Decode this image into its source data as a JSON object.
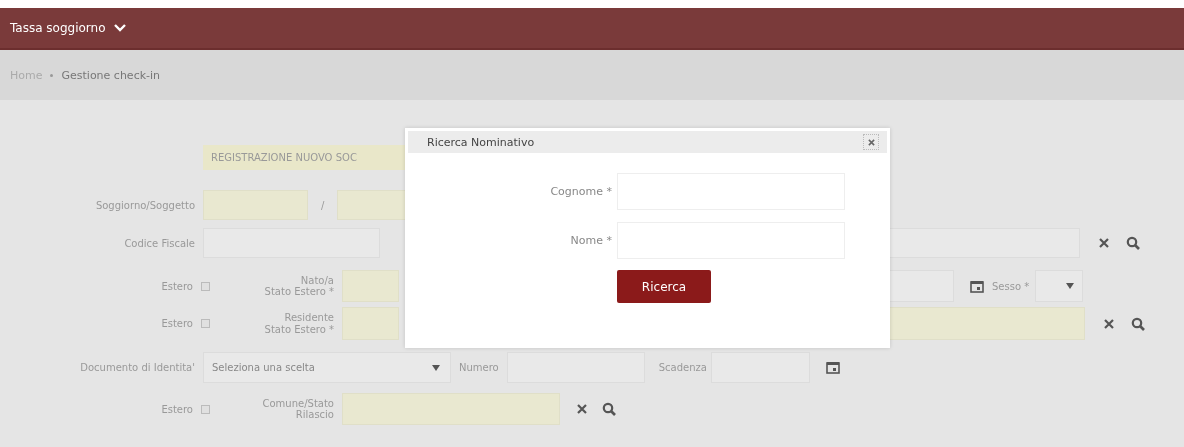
{
  "header": {
    "title": "Tassa soggiorno"
  },
  "breadcrumb": [
    "Home",
    "Gestione check-in"
  ],
  "form": {
    "banner": "REGISTRAZIONE NUOVO SOC",
    "soggiorno_label": "Soggiorno/Soggetto",
    "separator": "/",
    "codice_fiscale_label": "Codice Fiscale",
    "nascita": {
      "estero_label": "Estero",
      "estero_checked": false,
      "label": "Nato/a\nStato Estero *",
      "sesso_label": "Sesso *"
    },
    "residenza": {
      "estero_label": "Estero",
      "estero_checked": false,
      "label": "Residente\nStato Estero *"
    },
    "documento": {
      "label": "Documento di Identita'",
      "select_placeholder": "Seleziona una scelta",
      "numero_label": "Numero",
      "scadenza_label": "Scadenza"
    },
    "rilascio": {
      "estero_label": "Estero",
      "estero_checked": false,
      "label": "Comune/Stato\nRilascio"
    }
  },
  "modal": {
    "title": "Ricerca Nominativo",
    "fields": [
      {
        "label": "Cognome *"
      },
      {
        "label": "Nome *"
      }
    ],
    "button": "Ricerca"
  }
}
